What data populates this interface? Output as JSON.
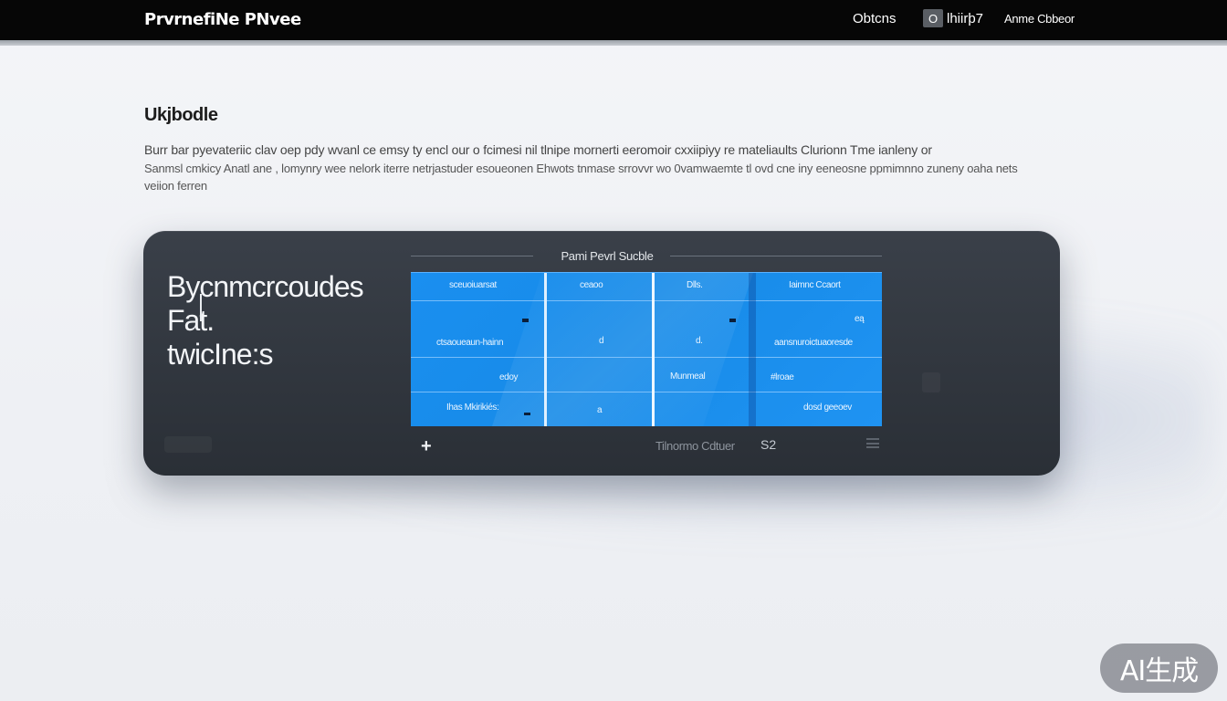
{
  "header": {
    "brand": "PrvrnefiNe PNvee",
    "options_label": "Obtcns",
    "library_icon": "O",
    "library_label": "lhiirþ7",
    "account_label": "Anme Cbbeor"
  },
  "section": {
    "heading": "Ukjbodle",
    "paragraph_lines": [
      "Burr bar pyevateriic clav oep pdy wvanl ce emsy ty encl our o fcimesi nil tlnipe mornerti eeromoir cxxiipiyy re mateliaults Clurionn Tme ianleny or",
      "Sanmsl cmkicy Anatl ane , lomynry wee nelork iterre netrjastuder esoueonen Ehwots tnmase srrovvr wo 0vamwaemte tl ovd cne iny eeneosne ppmimnno zuneny oaha nets",
      "veiion ferren"
    ]
  },
  "panel": {
    "title_lines": [
      "Bycnmcrcoudes",
      "Fat.",
      "twicIne:s"
    ],
    "grid_title": "Pami Pevrl Sucble",
    "grid": {
      "headers": [
        "sceuoiuarsat",
        "ceaoo",
        "Dlls.",
        "Iaimnc Ccaort"
      ],
      "cells": {
        "r1c4": "eą",
        "r2c1": "ctsaoueaun-hainn",
        "r2c2": "d",
        "r2c3": "d.",
        "r2c4": "aansnuroictuaoresde",
        "r3c1": "edoy",
        "r3c3": "Munmeal",
        "r3c4": "#lroae",
        "r4c1": "Ihas Mkirikiés:",
        "r4c2": "a",
        "r4c4": "dosd geeoev"
      }
    },
    "toolbar": {
      "add_label": "+",
      "caption": "Tilnormo Cdtuer",
      "link_label": "S2"
    }
  },
  "badge": "AI生成",
  "colors": {
    "header_bg": "#060606",
    "panel_bg": "#2f343b",
    "grid_blue": "#1a8ff0",
    "page_bg": "#f1f3f6"
  }
}
